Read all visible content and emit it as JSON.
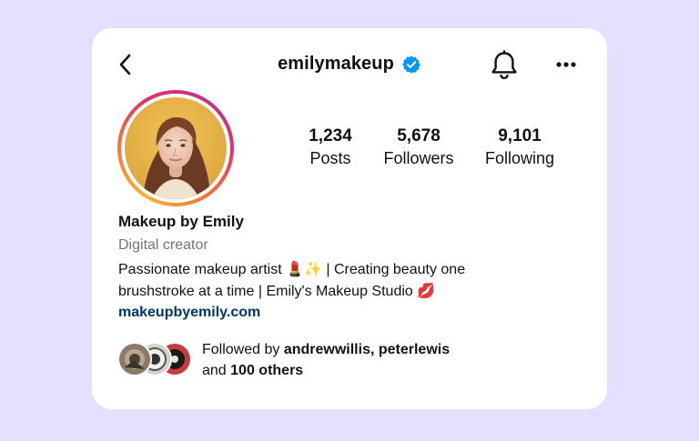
{
  "header": {
    "username": "emilymakeup",
    "verified": true,
    "icons": {
      "back": "chevron-left-icon",
      "verified": "verified-badge-icon",
      "notifications": "bell-icon",
      "more": "more-horizontal-icon"
    }
  },
  "stats": {
    "posts": {
      "value": "1,234",
      "label": "Posts"
    },
    "followers": {
      "value": "5,678",
      "label": "Followers"
    },
    "following": {
      "value": "9,101",
      "label": "Following"
    }
  },
  "profile": {
    "display_name": "Makeup by Emily",
    "category": "Digital creator",
    "bio_line1": "Passionate makeup artist 💄✨ | Creating beauty one",
    "bio_line2": "brushstroke at a time | Emily's Makeup Studio 💋",
    "website": "makeupbyemily.com"
  },
  "followed_by": {
    "prefix": "Followed by",
    "names": "andrewwillis, peterlewis",
    "connector": "and",
    "others": "100 others"
  },
  "colors": {
    "background": "#e5e0fd",
    "card": "#ffffff",
    "verified_blue": "#0095f6",
    "link": "#00376b",
    "secondary_text": "#737373"
  }
}
